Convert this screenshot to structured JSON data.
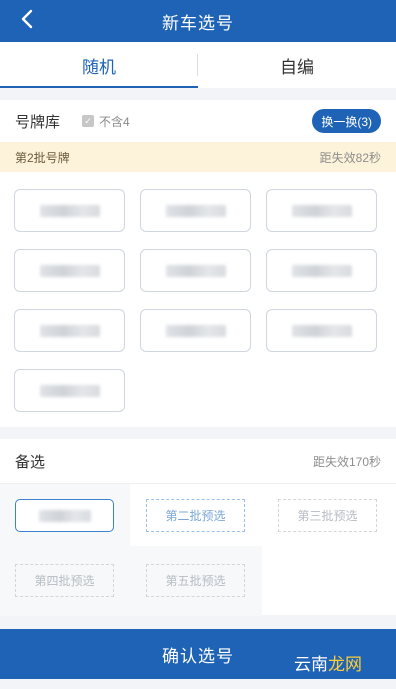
{
  "header": {
    "title": "新车选号",
    "back_icon": "chevron-left-icon"
  },
  "tabs": [
    {
      "label": "随机",
      "active": true
    },
    {
      "label": "自编",
      "active": false
    }
  ],
  "library": {
    "label": "号牌库",
    "exclude_four_label": "不含4",
    "exclude_four_checked": true,
    "swap_button_label": "换一换(3)"
  },
  "batch": {
    "label": "第2批号牌",
    "countdown": "距失效82秒"
  },
  "plates_count": 10,
  "backup": {
    "label": "备选",
    "countdown": "距失效170秒",
    "slots": [
      {
        "label": "",
        "state": "selected"
      },
      {
        "label": "第二批预选",
        "state": "active"
      },
      {
        "label": "第三批预选",
        "state": "disabled"
      },
      {
        "label": "第四批预选",
        "state": "disabled"
      },
      {
        "label": "第五批预选",
        "state": "disabled"
      }
    ]
  },
  "confirm_button_label": "确认选号",
  "watermark": {
    "text_a": "云南",
    "text_b": "龙网"
  },
  "colors": {
    "brand": "#1e63b5",
    "batch_bar": "#fdf3da"
  }
}
